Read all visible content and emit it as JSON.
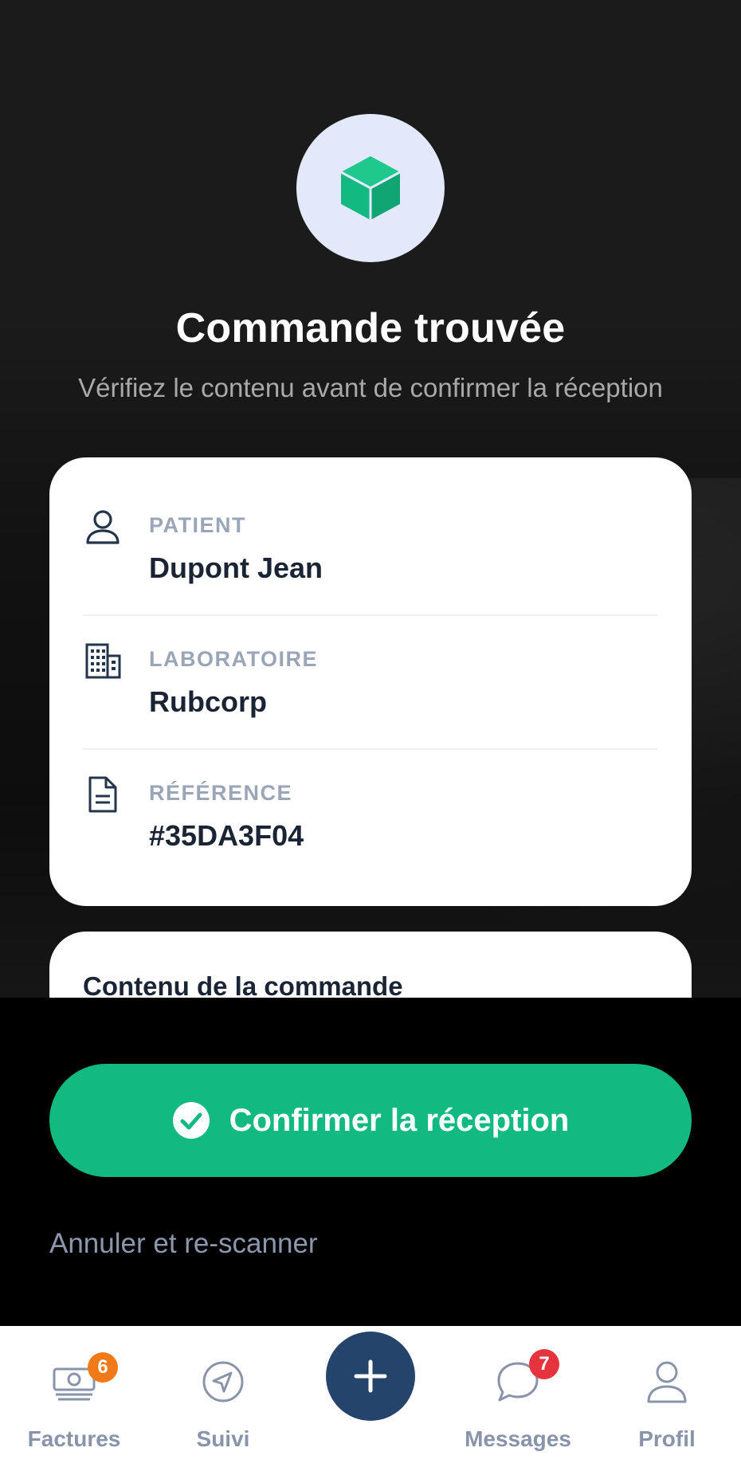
{
  "header": {
    "title": "Commande trouvée",
    "subtitle": "Vérifiez le contenu avant de confirmer la réception",
    "icon": "package-icon"
  },
  "details": [
    {
      "label": "PATIENT",
      "value": "Dupont Jean",
      "icon": "user-icon"
    },
    {
      "label": "LABORATOIRE",
      "value": "Rubcorp",
      "icon": "building-icon"
    },
    {
      "label": "RÉFÉRENCE",
      "value": "#35DA3F04",
      "icon": "document-icon"
    }
  ],
  "contents": {
    "heading": "Contenu de la commande"
  },
  "actions": {
    "confirm_label": "Confirmer la réception",
    "cancel_label": "Annuler et re-scanner"
  },
  "nav": {
    "items": [
      {
        "label": "Factures",
        "badge": "6",
        "icon": "invoice-icon"
      },
      {
        "label": "Suivi",
        "icon": "navigation-icon"
      },
      {
        "label": "Messages",
        "badge": "7",
        "icon": "chat-icon"
      },
      {
        "label": "Profil",
        "icon": "user-icon"
      }
    ],
    "fab_icon": "plus-icon"
  },
  "colors": {
    "accent_green": "#12b981",
    "navy": "#24446b",
    "badge_orange": "#f07a1a",
    "badge_red": "#e5343d"
  }
}
